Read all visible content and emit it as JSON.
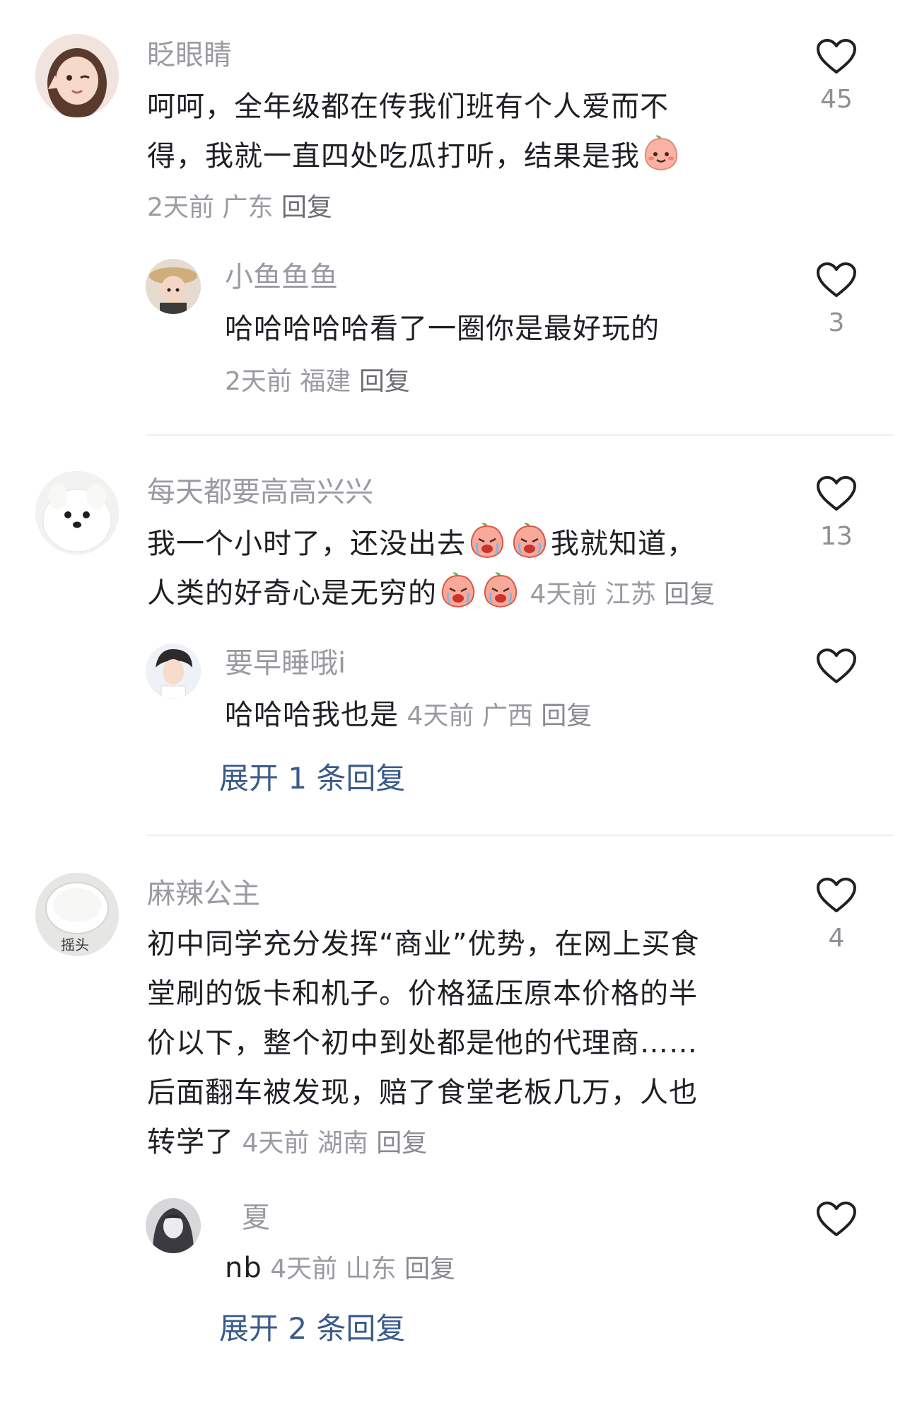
{
  "comments": [
    {
      "username": "眨眼睛",
      "text": "呵呵，全年级都在传我们班有个人爱而不得，我就一直四处吃瓜打听，结果是我",
      "line1": "呵呵，全年级都在传我们班有个人爱而不",
      "line2": "得，我就一直四处吃瓜打听，结果是我",
      "time": "2天前",
      "region": "广东",
      "reply_label": "回复",
      "likes": "45",
      "replies": [
        {
          "username": "小鱼鱼鱼",
          "text": "哈哈哈哈哈看了一圈你是最好玩的",
          "time": "2天前",
          "region": "福建",
          "reply_label": "回复",
          "likes": "3"
        }
      ]
    },
    {
      "username": "每天都要高高兴兴",
      "line1": "我一个小时了，还没出去",
      "line1b": "我就知道，",
      "line2": "人类的好奇心是无穷的",
      "time": "4天前",
      "region": "江苏",
      "reply_label": "回复",
      "likes": "13",
      "replies": [
        {
          "username": "要早睡哦i",
          "text": "哈哈哈我也是",
          "time": "4天前",
          "region": "广西",
          "reply_label": "回复",
          "likes": ""
        }
      ],
      "expand_label": "展开 1 条回复"
    },
    {
      "username": "麻辣公主",
      "avatar_text": "摇头",
      "line1": "初中同学充分发挥“商业”优势，在网上买食",
      "line2": "堂刷的饭卡和机子。价格猛压原本价格的半",
      "line3": "价以下，整个初中到处都是他的代理商……",
      "line4": "后面翻车被发现，赔了食堂老板几万，人也",
      "line5": "转学了",
      "time": "4天前",
      "region": "湖南",
      "reply_label": "回复",
      "likes": "4",
      "replies": [
        {
          "username": "夏",
          "text": "nb",
          "time": "4天前",
          "region": "山东",
          "reply_label": "回复",
          "likes": ""
        }
      ],
      "expand_label": "展开 2 条回复"
    }
  ],
  "colors": {
    "text": "#1f1f24",
    "meta": "#9a9aa2",
    "link": "#3a5a8a",
    "divider": "#efefef"
  },
  "icons": [
    "heart-outline-icon",
    "peach-smile-emoji",
    "crying-face-emoji"
  ]
}
